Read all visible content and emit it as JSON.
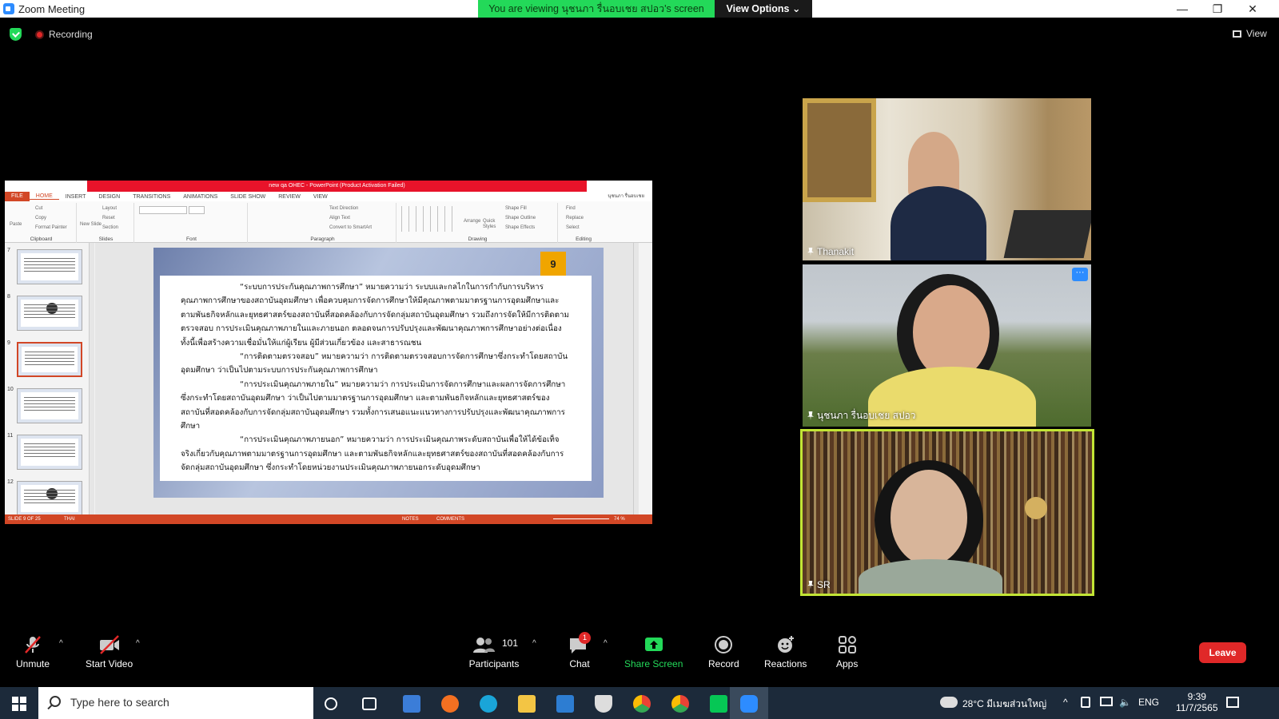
{
  "window": {
    "title": "Zoom Meeting",
    "viewing_banner": "You are viewing นุชนภา รื่นอบเชย สปอว's screen",
    "view_options": "View Options ⌄",
    "minimize": "—",
    "restore": "❐",
    "close": "✕"
  },
  "status": {
    "recording": "Recording",
    "view": "View"
  },
  "ppt": {
    "title": "new qa OHEC - PowerPoint (Product Activation Failed)",
    "tabs": [
      "FILE",
      "HOME",
      "INSERT",
      "DESIGN",
      "TRANSITIONS",
      "ANIMATIONS",
      "SLIDE SHOW",
      "REVIEW",
      "VIEW"
    ],
    "user": "นุชนภา รื่นอบเชย",
    "ribbon": {
      "clipboard": {
        "paste": "Paste",
        "cut": "Cut",
        "copy": "Copy",
        "format_painter": "Format Painter",
        "caption": "Clipboard"
      },
      "slides": {
        "new_slide": "New Slide",
        "layout": "Layout",
        "reset": "Reset",
        "section": "Section",
        "caption": "Slides"
      },
      "font": {
        "caption": "Font"
      },
      "paragraph": {
        "text_direction": "Text Direction",
        "align_text": "Align Text",
        "smartart": "Convert to SmartArt",
        "caption": "Paragraph"
      },
      "drawing": {
        "arrange": "Arrange",
        "quick_styles": "Quick Styles",
        "shape_fill": "Shape Fill",
        "shape_outline": "Shape Outline",
        "shape_effects": "Shape Effects",
        "caption": "Drawing"
      },
      "editing": {
        "find": "Find",
        "replace": "Replace",
        "select": "Select",
        "caption": "Editing"
      }
    },
    "thumb_numbers": [
      "7",
      "8",
      "9",
      "10",
      "11",
      "12"
    ],
    "slide_number": "9",
    "slide_paragraphs": [
      "“ระบบการประกันคุณภาพการศึกษา” หมายความว่า ระบบและกลไกในการกำกับการบริหารคุณภาพการศึกษาของสถาบันอุดมศึกษา เพื่อควบคุมการจัดการศึกษาให้มีคุณภาพตามมาตรฐานการอุดมศึกษาและตามพันธกิจหลักและยุทธศาสตร์ของสถาบันที่สอดคล้องกับการจัดกลุ่มสถาบันอุดมศึกษา รวมถึงการจัดให้มีการติดตามตรวจสอบ การประเมินคุณภาพภายในและภายนอก ตลอดจนการปรับปรุงและพัฒนาคุณภาพการศึกษาอย่างต่อเนื่อง ทั้งนี้เพื่อสร้างความเชื่อมั่นให้แก่ผู้เรียน ผู้มีส่วนเกี่ยวข้อง และสาธารณชน",
      "“การติดตามตรวจสอบ” หมายความว่า การติดตามตรวจสอบการจัดการศึกษาซึ่งกระทำโดยสถาบันอุดมศึกษา ว่าเป็นไปตามระบบการประกันคุณภาพการศึกษา",
      "“การประเมินคุณภาพภายใน” หมายความว่า การประเมินการจัดการศึกษาและผลการจัดการศึกษาซึ่งกระทำโดยสถาบันอุดมศึกษา ว่าเป็นไปตามมาตรฐานการอุดมศึกษา และตามพันธกิจหลักและยุทธศาสตร์ของสถาบันที่สอดคล้องกับการจัดกลุ่มสถาบันอุดมศึกษา รวมทั้งการเสนอแนะแนวทางการปรับปรุงและพัฒนาคุณภาพการศึกษา",
      "“การประเมินคุณภาพภายนอก” หมายความว่า การประเมินคุณภาพระดับสถาบันเพื่อให้ได้ข้อเท็จจริงเกี่ยวกับคุณภาพตามมาตรฐานการอุดมศึกษา และตามพันธกิจหลักและยุทธศาสตร์ของสถาบันที่สอดคล้องกับการจัดกลุ่มสถาบันอุดมศึกษา ซึ่งกระทำโดยหน่วยงานประเมินคุณภาพภายนอกระดับอุดมศึกษา"
    ],
    "statusbar": {
      "slide_info": "SLIDE 9 OF 25",
      "language": "THAI",
      "notes": "NOTES",
      "comments": "COMMENTS",
      "zoom": "74 %"
    }
  },
  "participants_tiles": [
    {
      "name": "Thanakit"
    },
    {
      "name": "นุชนภา รื่นอบเชย สปอว"
    },
    {
      "name": "SR"
    }
  ],
  "toolbar": {
    "unmute": "Unmute",
    "start_video": "Start Video",
    "participants": "Participants",
    "participants_count": "101",
    "chat": "Chat",
    "chat_badge": "1",
    "share_screen": "Share Screen",
    "record": "Record",
    "reactions": "Reactions",
    "apps": "Apps",
    "leave": "Leave"
  },
  "taskbar": {
    "search_placeholder": "Type here to search",
    "weather": "28°C มีเมฆส่วนใหญ่",
    "language": "ENG",
    "time": "9:39",
    "date": "11/7/2565"
  },
  "colors": {
    "zoom_blue": "#2d8cff",
    "green": "#23d959",
    "leave_red": "#e02828",
    "ppt_orange": "#d24726",
    "active_speaker": "#c2e535"
  }
}
